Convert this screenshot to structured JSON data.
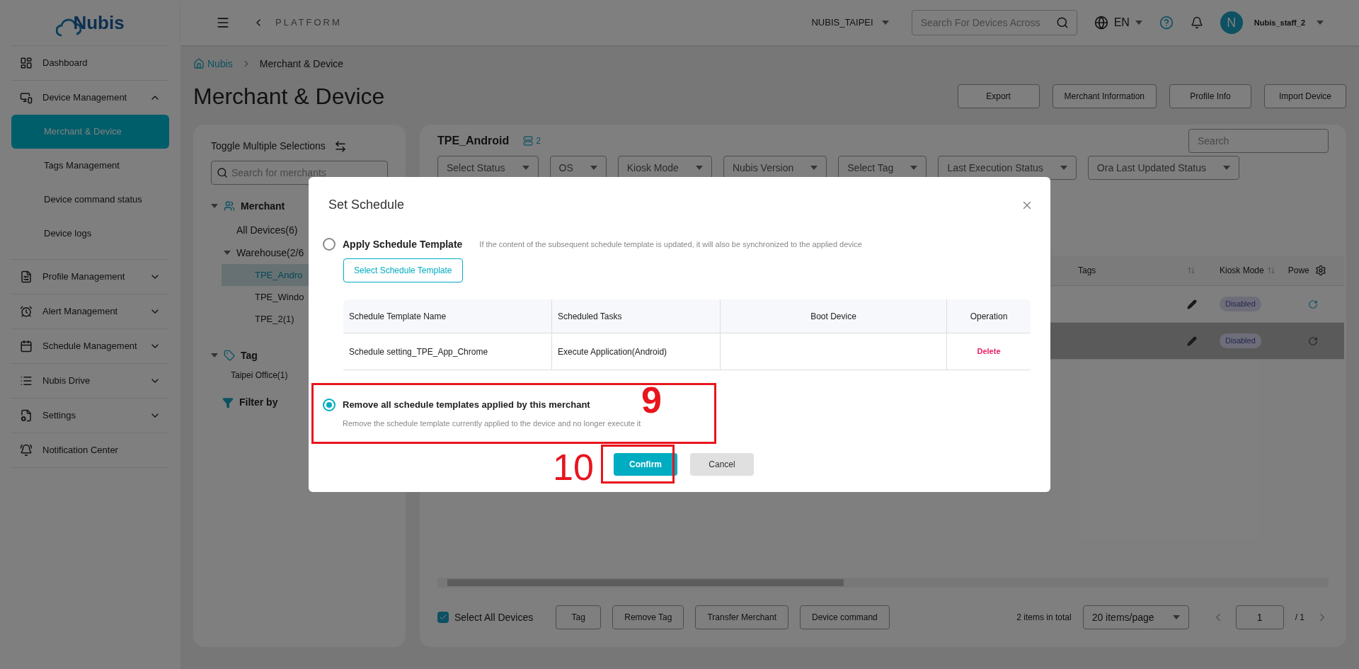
{
  "header": {
    "logo": "Nubis",
    "platform": "PLATFORM",
    "merchant": "NUBIS_TAIPEI",
    "search": {
      "placeholder": "Search For Devices Across"
    },
    "language": "EN",
    "avatar": "N",
    "user": "Nubis_staff_2"
  },
  "sidebar": {
    "items": [
      {
        "label": "Dashboard"
      },
      {
        "label": "Device Management",
        "expanded": true,
        "children": [
          {
            "label": "Merchant & Device",
            "selected": true
          },
          {
            "label": "Tags Management",
            "selected": false
          },
          {
            "label": "Device command status",
            "selected": false
          },
          {
            "label": "Device logs",
            "selected": false
          }
        ]
      },
      {
        "label": "Profile Management",
        "expanded": false
      },
      {
        "label": "Alert Management",
        "expanded": false
      },
      {
        "label": "Schedule Management",
        "expanded": false
      },
      {
        "label": "Nubis Drive",
        "expanded": false
      },
      {
        "label": "Settings",
        "expanded": false
      },
      {
        "label": "Notification Center"
      }
    ]
  },
  "breadcrumb": [
    "Nubis",
    "Merchant & Device"
  ],
  "page_title": "Merchant & Device",
  "actions": [
    "Export",
    "Merchant Information",
    "Profile Info",
    "Import Device"
  ],
  "tree_panel": {
    "toggle": "Toggle Multiple Selections",
    "search": {
      "placeholder": "Search for merchants"
    },
    "merchant": {
      "label": "Merchant",
      "expanded": true,
      "children": [
        {
          "label": "All Devices(6)",
          "selected": false
        },
        {
          "label": "Warehouse(2/6",
          "selected": false,
          "expanded": true,
          "children": [
            {
              "label": "TPE_Andro",
              "selected": true
            },
            {
              "label": "TPE_Windo",
              "selected": false
            },
            {
              "label": "TPE_2(1)",
              "selected": false
            }
          ]
        }
      ]
    },
    "tag": {
      "label": "Tag",
      "expanded": true,
      "children": [
        {
          "label": "Taipei Office(1)"
        }
      ]
    },
    "filter": "Filter by"
  },
  "device_panel": {
    "title": "TPE_Android",
    "count": "2",
    "search": {
      "placeholder": "Search"
    },
    "filters": [
      "Select Status",
      "OS",
      "Kiosk Mode",
      "Nubis Version",
      "Select Tag",
      "Last Execution Status",
      "Ora Last Updated Status"
    ],
    "columns": [
      "Tags",
      "Kiosk Mode",
      "Powe"
    ],
    "rows": [
      {
        "kiosk": "Disabled",
        "selected": false
      },
      {
        "kiosk": "Disabled",
        "selected": true
      }
    ],
    "select_all": {
      "label": "Select All Devices",
      "checked": true
    },
    "bulk_actions": [
      "Tag",
      "Remove Tag",
      "Transfer Merchant",
      "Device command"
    ],
    "total": "2 items in total",
    "page_size": "20 items/page",
    "page": "1",
    "pages": "/ 1"
  },
  "dialog": {
    "title": "Set Schedule",
    "options": [
      {
        "kind": "apply",
        "label": "Apply Schedule Template",
        "hint": "If the content of the subsequent schedule template is updated, it will also be synchronized to the applied device",
        "selected": false,
        "button": "Select Schedule Template",
        "table": {
          "columns": [
            "Schedule Template Name",
            "Scheduled Tasks",
            "Boot Device",
            "Operation"
          ],
          "rows": [
            [
              "Schedule setting_TPE_App_Chrome",
              "Execute Application(Android)",
              "",
              "Delete"
            ]
          ]
        }
      },
      {
        "kind": "remove",
        "label": "Remove all schedule templates applied by this merchant",
        "description": "Remove the schedule template currently applied to the device and no longer execute it",
        "selected": true
      }
    ],
    "buttons": [
      {
        "label": "Confirm",
        "kind": "primary"
      },
      {
        "label": "Cancel",
        "kind": "secondary"
      }
    ]
  },
  "annotations": [
    {
      "label": "9"
    },
    {
      "label": "10"
    }
  ]
}
